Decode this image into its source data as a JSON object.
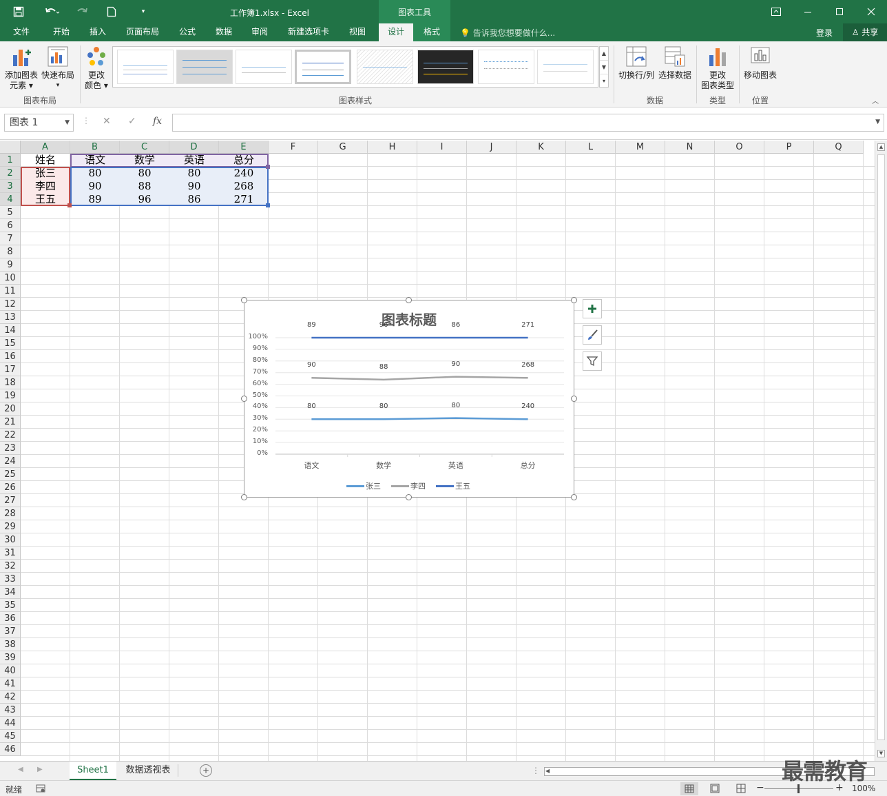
{
  "window": {
    "title": "工作簿1.xlsx - Excel",
    "tools_context": "图表工具"
  },
  "tabs": [
    {
      "label": "文件"
    },
    {
      "label": "开始"
    },
    {
      "label": "插入"
    },
    {
      "label": "页面布局"
    },
    {
      "label": "公式"
    },
    {
      "label": "数据"
    },
    {
      "label": "审阅"
    },
    {
      "label": "新建选项卡"
    },
    {
      "label": "视图"
    },
    {
      "label": "设计"
    },
    {
      "label": "格式"
    }
  ],
  "tell_me": "告诉我您想要做什么...",
  "account": {
    "login": "登录",
    "share": "共享"
  },
  "ribbon": {
    "add_element": "添加图表",
    "add_element_2": "元素",
    "quick_layout": "快速布局",
    "change_color": "更改",
    "change_color_2": "颜色",
    "group_layout": "图表布局",
    "group_styles": "图表样式",
    "switch_rowcol": "切换行/列",
    "select_data": "选择数据",
    "group_data": "数据",
    "change_type": "更改",
    "change_type_2": "图表类型",
    "group_type": "类型",
    "move_chart": "移动图表",
    "group_location": "位置"
  },
  "formula_bar": {
    "name_box": "图表 1",
    "fx": "fx",
    "value": ""
  },
  "columns": [
    "A",
    "B",
    "C",
    "D",
    "E",
    "F",
    "G",
    "H",
    "I",
    "J",
    "K",
    "L",
    "M",
    "N",
    "O",
    "P",
    "Q"
  ],
  "row_count": 46,
  "table": {
    "headers": [
      "姓名",
      "语文",
      "数学",
      "英语",
      "总分"
    ],
    "rows": [
      [
        "张三",
        "80",
        "80",
        "80",
        "240"
      ],
      [
        "李四",
        "90",
        "88",
        "90",
        "268"
      ],
      [
        "王五",
        "89",
        "96",
        "86",
        "271"
      ]
    ]
  },
  "chart_data": {
    "type": "line",
    "title": "图表标题",
    "categories": [
      "语文",
      "数学",
      "英语",
      "总分"
    ],
    "y_ticks": [
      "100%",
      "90%",
      "80%",
      "70%",
      "60%",
      "50%",
      "40%",
      "30%",
      "20%",
      "10%",
      "0%"
    ],
    "ylim": [
      0,
      1
    ],
    "grid": true,
    "legend_position": "bottom",
    "series": [
      {
        "name": "张三",
        "color": "#5b9bd5",
        "values": [
          80,
          80,
          80,
          240
        ],
        "plotted_share": [
          0.3,
          0.3,
          0.31,
          0.3
        ]
      },
      {
        "name": "李四",
        "color": "#a5a5a5",
        "values": [
          90,
          88,
          90,
          268
        ],
        "plotted_share": [
          0.655,
          0.64,
          0.665,
          0.655
        ]
      },
      {
        "name": "王五",
        "color": "#4472c4",
        "values": [
          89,
          96,
          86,
          271
        ],
        "plotted_share": [
          1.0,
          1.0,
          1.0,
          1.0
        ]
      }
    ]
  },
  "sheets": [
    {
      "label": "Sheet1"
    },
    {
      "label": "数据透视表"
    }
  ],
  "status": {
    "ready": "就绪",
    "zoom": "100%"
  },
  "watermark": "最需教育"
}
